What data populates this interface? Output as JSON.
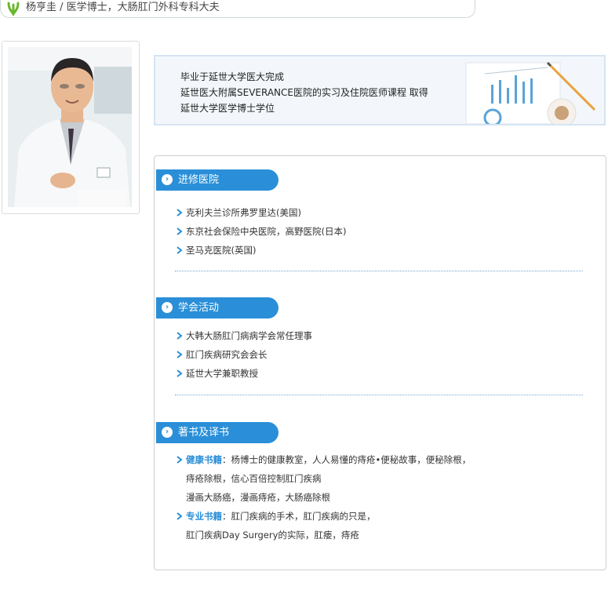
{
  "header": {
    "title": "杨亨圭 / 医学博士，大肠肛门外科专科大夫"
  },
  "intro": {
    "lines": [
      "毕业于延世大学医大完成",
      "延世医大附属SEVERANCE医院的实习及住院医师课程 取得",
      "延世大学医学博士学位"
    ]
  },
  "sections": [
    {
      "title": "进修医院",
      "items": [
        "克利夫兰诊所弗罗里达(美国)",
        "东京社会保险中央医院，高野医院(日本)",
        "圣马克医院(英国)"
      ]
    },
    {
      "title": "学会活动",
      "items": [
        "大韩大肠肛门病病学会常任理事",
        "肛门疾病研究会会长",
        "延世大学兼职教授"
      ]
    },
    {
      "title": "著书及译书",
      "entries": [
        {
          "label": "健康书籍",
          "text": "：杨博士的健康教室，人人易懂的痔疮•便秘故事，便秘除根，",
          "continuation": [
            "痔疮除根，信心百倍控制肛门疾病",
            "漫画大肠癌，漫画痔疮，大肠癌除根"
          ]
        },
        {
          "label": "专业书籍",
          "text": "：肛门疾病的手术，肛门疾病的只是，",
          "continuation": [
            "肛门疾病Day Surgery的实际，肛瘘，痔疮"
          ]
        }
      ]
    }
  ],
  "colors": {
    "accent": "#2a8fd8",
    "intro_bg": "#f3f7fb",
    "logo_green": "#6ab72d"
  }
}
